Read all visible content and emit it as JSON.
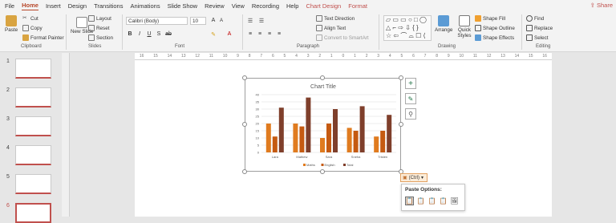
{
  "menu": {
    "tabs": [
      "File",
      "Home",
      "Insert",
      "Design",
      "Transitions",
      "Animations",
      "Slide Show",
      "Review",
      "View",
      "Recording",
      "Help",
      "Chart Design",
      "Format"
    ],
    "share": "Share"
  },
  "ribbon": {
    "clipboard": {
      "paste": "Paste",
      "cut": "Cut",
      "copy": "Copy",
      "format_painter": "Format Painter",
      "label": "Clipboard"
    },
    "slides": {
      "new_slide": "New Slide",
      "layout": "Layout",
      "reset": "Reset",
      "section": "Section",
      "label": "Slides"
    },
    "font": {
      "name": "Calibri (Body)",
      "size": "10",
      "label": "Font"
    },
    "paragraph": {
      "text_direction": "Text Direction",
      "align_text": "Align Text",
      "smartart": "Convert to SmartArt",
      "label": "Paragraph"
    },
    "drawing": {
      "arrange": "Arrange",
      "quick_styles": "Quick Styles",
      "shape_fill": "Shape Fill",
      "shape_outline": "Shape Outline",
      "shape_effects": "Shape Effects",
      "label": "Drawing"
    },
    "editing": {
      "find": "Find",
      "replace": "Replace",
      "select": "Select",
      "label": "Editing"
    }
  },
  "slides": [
    "1",
    "2",
    "3",
    "4",
    "5",
    "6"
  ],
  "ruler_ticks": [
    "16",
    "15",
    "14",
    "13",
    "12",
    "11",
    "10",
    "9",
    "8",
    "7",
    "6",
    "5",
    "4",
    "3",
    "2",
    "1",
    "0",
    "1",
    "2",
    "3",
    "4",
    "5",
    "6",
    "7",
    "8",
    "9",
    "10",
    "11",
    "12",
    "13",
    "14",
    "15",
    "16"
  ],
  "ctrl_tag": "(Ctrl)",
  "paste_options": "Paste Options:",
  "colors": {
    "maths": "#e07b1f",
    "english": "#c55a11",
    "total": "#7f3f2b",
    "accent": "#b7472a"
  },
  "chart_data": {
    "type": "bar",
    "title": "Chart Title",
    "categories": [
      "Lara",
      "Mathew",
      "Sara",
      "Sneha",
      "Tristen"
    ],
    "series": [
      {
        "name": "Maths",
        "values": [
          20,
          20,
          10,
          17,
          11
        ]
      },
      {
        "name": "English",
        "values": [
          11,
          18,
          20,
          15,
          15
        ]
      },
      {
        "name": "Total",
        "values": [
          31,
          38,
          30,
          32,
          26
        ]
      }
    ],
    "ylim": [
      0,
      40
    ],
    "yticks": [
      "0",
      "5",
      "10",
      "15",
      "20",
      "25",
      "30",
      "35",
      "40"
    ],
    "grid": true,
    "legend": "bottom"
  }
}
